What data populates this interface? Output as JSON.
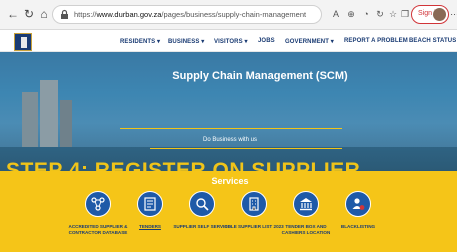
{
  "browser": {
    "url_prefix": "https://",
    "url_domain": "www.durban.gov.za",
    "url_path": "/pages/business/supply-chain-management",
    "signin_label": "Sign in"
  },
  "site": {
    "nav": [
      "RESIDENTS ▾",
      "BUSINESS ▾",
      "VISITORS ▾",
      "JOBS",
      "GOVERNMENT ▾",
      "REPORT A PROBLEM",
      "BEACH STATUS"
    ]
  },
  "hero": {
    "title": "Supply Chain Management (SCM)",
    "subtitle": "Do Business with us",
    "banner_text": "STEP 4: REGISTER ON SUPPLIER"
  },
  "services": {
    "title": "Services",
    "items": [
      {
        "label": "ACCREDITED SUPPLIER & CONTRACTOR DATABASE",
        "icon": "network-icon"
      },
      {
        "label": "TENDERS",
        "icon": "document-icon"
      },
      {
        "label": "SUPPLIER SELF SERVICE",
        "icon": "search-icon"
      },
      {
        "label": "SOLE SUPPLIER LIST 2023",
        "icon": "building-icon"
      },
      {
        "label": "TENDER BOX AND CASHIERS LOCATION",
        "icon": "bank-icon"
      },
      {
        "label": "BLACKLISTING",
        "icon": "blacklist-user-icon"
      }
    ]
  },
  "colors": {
    "navy": "#1a3b73",
    "gold": "#f5c518",
    "accent_blue": "#1e5aa8"
  }
}
